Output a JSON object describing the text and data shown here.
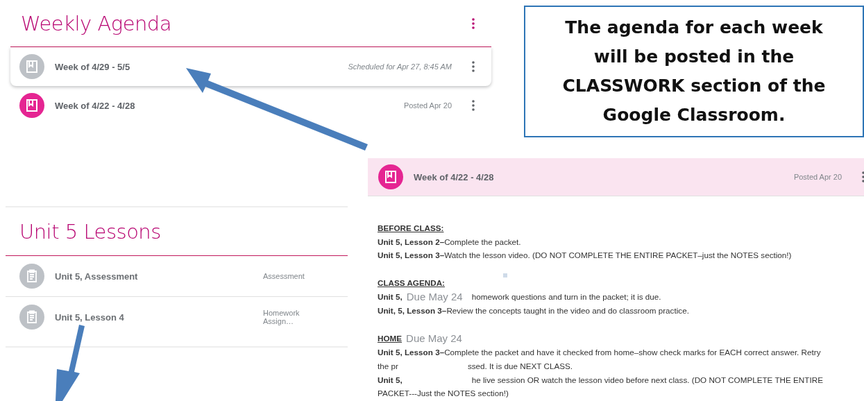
{
  "weekly_agenda": {
    "title": "Weekly Agenda",
    "items": [
      {
        "title": "Week of 4/29 - 5/5",
        "status": "Scheduled for Apr 27, 8:45 AM",
        "kind": "scheduled",
        "selected": true
      },
      {
        "title": "Week of 4/22 - 4/28",
        "status": "Posted Apr 20",
        "kind": "posted",
        "selected": false
      }
    ]
  },
  "callout": {
    "text": "The agenda for each week will be posted in the CLASSWORK section of the Google Classroom."
  },
  "unit_lessons": {
    "title": "Unit 5 Lessons",
    "items": [
      {
        "title": "Unit 5, Assessment",
        "category": "Assessment"
      },
      {
        "title": "Unit 5, Lesson 4",
        "category": "Homework Assign…"
      }
    ]
  },
  "post": {
    "title": "Week of 4/22 - 4/28",
    "status": "Posted Apr 20",
    "body": [
      {
        "kind": "heading",
        "text": "BEFORE CLASS:"
      },
      {
        "kind": "text",
        "text": "**Unit 5, Lesson 2–**Complete the packet."
      },
      {
        "kind": "text",
        "text": "**Unit 5, Lesson 3–**Watch the lesson video. (DO NOT COMPLETE THE ENTIRE PACKET–just the NOTES section!)"
      },
      {
        "kind": "heading",
        "text": "CLASS AGENDA:"
      },
      {
        "kind": "covered",
        "before": "**Unit 5,**",
        "overlay": "Due May 24",
        "after": "homework questions and turn in the packet; it is due."
      },
      {
        "kind": "text",
        "text": "**Unit, 5, Lesson 3–**Review the concepts taught in the video and do classroom practice."
      },
      {
        "kind": "covered-heading",
        "before": "HOME",
        "overlay": "Due May 24"
      },
      {
        "kind": "text",
        "text": "**Unit 5, Lesson 3–**Complete the packet and have it checked from home–show check marks for EACH correct answer. Retry"
      },
      {
        "kind": "covered",
        "before": "the pr",
        "after": "ssed. It is due NEXT CLASS."
      },
      {
        "kind": "covered",
        "before": "**Unit 5,**",
        "after": "he live session OR watch the lesson video before next class. (DO NOT COMPLETE THE ENTIRE"
      },
      {
        "kind": "text",
        "text": "PACKET---Just the NOTES section!)"
      }
    ]
  }
}
